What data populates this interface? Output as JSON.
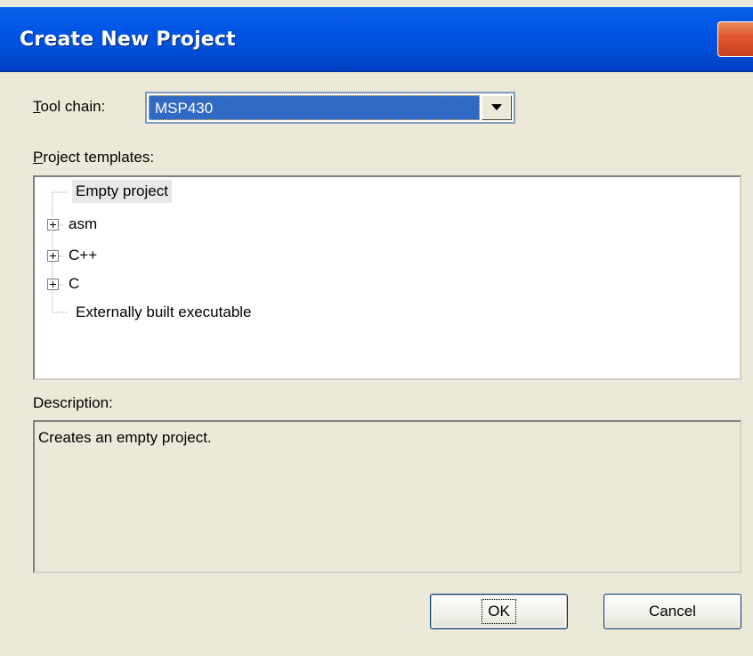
{
  "window": {
    "title": "Create New Project"
  },
  "toolchain": {
    "label_mnemonic": "T",
    "label_rest": "ool chain:",
    "value": "MSP430"
  },
  "templates": {
    "label_mnemonic": "P",
    "label_rest": "roject templates:",
    "items": [
      {
        "label": "Empty project",
        "expandable": false,
        "selected": true
      },
      {
        "label": "asm",
        "expandable": true,
        "selected": false
      },
      {
        "label": "C++",
        "expandable": true,
        "selected": false
      },
      {
        "label": "C",
        "expandable": true,
        "selected": false
      },
      {
        "label": "Externally built executable",
        "expandable": false,
        "selected": false
      }
    ]
  },
  "description": {
    "label": "Description:",
    "text": "Creates an empty project."
  },
  "buttons": {
    "ok": "OK",
    "cancel": "Cancel"
  },
  "colors": {
    "titlebar": "#0054e3",
    "selection": "#316ac5",
    "dialog_bg": "#ece9d8"
  }
}
